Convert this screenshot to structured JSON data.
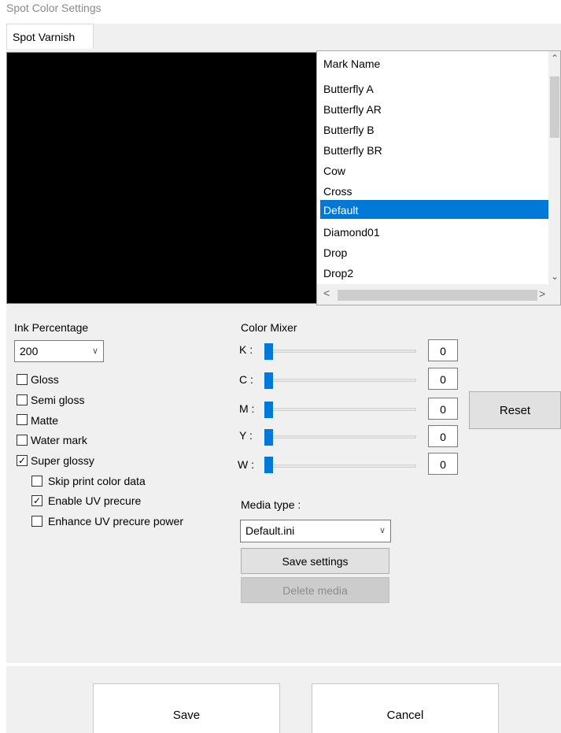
{
  "window": {
    "title": "Spot Color Settings"
  },
  "tabs": [
    {
      "label": "Spot Varnish"
    }
  ],
  "mark_list": {
    "header": "Mark Name",
    "items": [
      {
        "label": "Butterfly A"
      },
      {
        "label": "Butterfly AR"
      },
      {
        "label": "Butterfly B"
      },
      {
        "label": "Butterfly BR"
      },
      {
        "label": "Cow"
      },
      {
        "label": "Cross"
      },
      {
        "label": "Default",
        "selected": true
      },
      {
        "label": "Diamond01"
      },
      {
        "label": "Drop"
      },
      {
        "label": "Drop2"
      }
    ],
    "scroll_up_glyph": "⌃",
    "scroll_down_glyph": "⌄",
    "scroll_left_glyph": "<",
    "scroll_right_glyph": ">"
  },
  "ink": {
    "label": "Ink Percentage",
    "selected_value": "200",
    "dropdown_glyph": "∨"
  },
  "finish_options": [
    {
      "label": "Gloss",
      "checked": false
    },
    {
      "label": "Semi gloss",
      "checked": false
    },
    {
      "label": "Matte",
      "checked": false
    },
    {
      "label": "Water mark",
      "checked": false
    },
    {
      "label": "Super glossy",
      "checked": true
    }
  ],
  "sub_options": [
    {
      "label": "Skip print color data",
      "checked": false
    },
    {
      "label": "Enable UV precure",
      "checked": true
    },
    {
      "label": "Enhance UV precure power",
      "checked": false
    }
  ],
  "check_glyph": "✓",
  "color_mixer": {
    "label": "Color Mixer",
    "channels": [
      {
        "letter": "K :",
        "value": "0",
        "level": 0
      },
      {
        "letter": "C :",
        "value": "0",
        "level": 0
      },
      {
        "letter": "M :",
        "value": "0",
        "level": 0
      },
      {
        "letter": "Y :",
        "value": "0",
        "level": 0
      },
      {
        "letter": "W :",
        "value": "0",
        "level": 0
      }
    ],
    "reset_label": "Reset"
  },
  "media": {
    "label": "Media type :",
    "selected_value": "Default.ini",
    "dropdown_glyph": "∨",
    "save_settings_label": "Save settings",
    "delete_media_label": "Delete media"
  },
  "footer": {
    "save_label": "Save",
    "cancel_label": "Cancel"
  },
  "colors": {
    "selection": "#0078d7",
    "slider_thumb": "#0078d7",
    "panel": "#f0f0f0",
    "preview": "#000000"
  }
}
